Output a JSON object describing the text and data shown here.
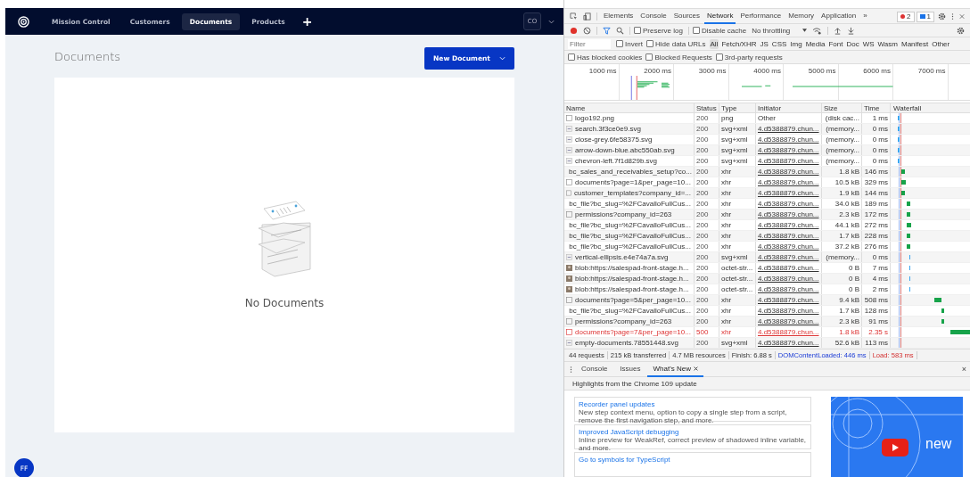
{
  "app": {
    "nav": [
      {
        "label": "Mission Control",
        "selected": false
      },
      {
        "label": "Customers",
        "selected": false
      },
      {
        "label": "Documents",
        "selected": true
      },
      {
        "label": "Products",
        "selected": false
      }
    ],
    "add_tab": "+",
    "account": "CO",
    "page_title": "Documents",
    "new_button": "New Document",
    "empty_text": "No Documents",
    "user_initials": "FF"
  },
  "devtools": {
    "tabs": [
      {
        "label": "Elements",
        "selected": false
      },
      {
        "label": "Console",
        "selected": false
      },
      {
        "label": "Sources",
        "selected": false
      },
      {
        "label": "Network",
        "selected": true
      },
      {
        "label": "Performance",
        "selected": false
      },
      {
        "label": "Memory",
        "selected": false
      },
      {
        "label": "Application",
        "selected": false
      }
    ],
    "more_tabs": "»",
    "error_count": "2",
    "message_count": "1",
    "toolbar": {
      "preserve_log": {
        "label": "Preserve log",
        "checked": false
      },
      "disable_cache": {
        "label": "Disable cache",
        "checked": false
      },
      "throttling": "No throttling"
    },
    "filter": {
      "placeholder": "Filter",
      "options": [
        {
          "label": "Invert",
          "checked": false
        },
        {
          "label": "Hide data URLs",
          "checked": false
        }
      ],
      "types": [
        {
          "label": "All",
          "selected": true
        },
        {
          "label": "Fetch/XHR",
          "selected": false
        },
        {
          "label": "JS",
          "selected": false
        },
        {
          "label": "CSS",
          "selected": false
        },
        {
          "label": "Img",
          "selected": false
        },
        {
          "label": "Media",
          "selected": false
        },
        {
          "label": "Font",
          "selected": false
        },
        {
          "label": "Doc",
          "selected": false
        },
        {
          "label": "WS",
          "selected": false
        },
        {
          "label": "Wasm",
          "selected": false
        },
        {
          "label": "Manifest",
          "selected": false
        },
        {
          "label": "Other",
          "selected": false
        }
      ],
      "extra": [
        {
          "label": "Has blocked cookies",
          "checked": false
        },
        {
          "label": "Blocked Requests",
          "checked": false
        },
        {
          "label": "3rd-party requests",
          "checked": false
        }
      ]
    },
    "overview_ticks": [
      "1000 ms",
      "2000 ms",
      "3000 ms",
      "4000 ms",
      "5000 ms",
      "6000 ms",
      "7000 ms"
    ],
    "columns": [
      "Name",
      "Status",
      "Type",
      "Initiator",
      "Size",
      "Time",
      "Waterfall"
    ],
    "rows": [
      {
        "kind": "doc",
        "name": "logo192.png",
        "status": "200",
        "type": "png",
        "initiator": "Other",
        "size": "(disk cac...",
        "time": "1 ms",
        "failed": false
      },
      {
        "kind": "image",
        "name": "search.3f3ce0e9.svg",
        "status": "200",
        "type": "svg+xml",
        "initiator": "4.d5388879.chun...",
        "size": "(memory...",
        "time": "0 ms",
        "failed": false
      },
      {
        "kind": "image",
        "name": "close-grey.6fe58375.svg",
        "status": "200",
        "type": "svg+xml",
        "initiator": "4.d5388879.chun...",
        "size": "(memory...",
        "time": "0 ms",
        "failed": false
      },
      {
        "kind": "image",
        "name": "arrow-down-blue.abc550ab.svg",
        "status": "200",
        "type": "svg+xml",
        "initiator": "4.d5388879.chun...",
        "size": "(memory...",
        "time": "0 ms",
        "failed": false
      },
      {
        "kind": "image",
        "name": "chevron-left.7f1d829b.svg",
        "status": "200",
        "type": "svg+xml",
        "initiator": "4.d5388879.chun...",
        "size": "(memory...",
        "time": "0 ms",
        "failed": false
      },
      {
        "kind": "doc",
        "name": "bc_sales_and_receivables_setup?co...",
        "status": "200",
        "type": "xhr",
        "initiator": "4.d5388879.chun...",
        "size": "1.8 kB",
        "time": "146 ms",
        "failed": false
      },
      {
        "kind": "doc",
        "name": "documents?page=1&per_page=10...",
        "status": "200",
        "type": "xhr",
        "initiator": "4.d5388879.chun...",
        "size": "10.5 kB",
        "time": "329 ms",
        "failed": false
      },
      {
        "kind": "doc",
        "name": "customer_templates?company_id=...",
        "status": "200",
        "type": "xhr",
        "initiator": "4.d5388879.chun...",
        "size": "1.9 kB",
        "time": "144 ms",
        "failed": false
      },
      {
        "kind": "doc",
        "name": "bc_file?bc_slug=%2FCavalloFullCus...",
        "status": "200",
        "type": "xhr",
        "initiator": "4.d5388879.chun...",
        "size": "34.0 kB",
        "time": "189 ms",
        "failed": false
      },
      {
        "kind": "doc",
        "name": "permissions?company_id=263",
        "status": "200",
        "type": "xhr",
        "initiator": "4.d5388879.chun...",
        "size": "2.3 kB",
        "time": "172 ms",
        "failed": false
      },
      {
        "kind": "doc",
        "name": "bc_file?bc_slug=%2FCavalloFullCus...",
        "status": "200",
        "type": "xhr",
        "initiator": "4.d5388879.chun...",
        "size": "44.1 kB",
        "time": "272 ms",
        "failed": false
      },
      {
        "kind": "doc",
        "name": "bc_file?bc_slug=%2FCavalloFullCus...",
        "status": "200",
        "type": "xhr",
        "initiator": "4.d5388879.chun...",
        "size": "1.7 kB",
        "time": "228 ms",
        "failed": false
      },
      {
        "kind": "doc",
        "name": "bc_file?bc_slug=%2FCavalloFullCus...",
        "status": "200",
        "type": "xhr",
        "initiator": "4.d5388879.chun...",
        "size": "37.2 kB",
        "time": "276 ms",
        "failed": false
      },
      {
        "kind": "image",
        "name": "vertical-ellipsis.e4e74a7a.svg",
        "status": "200",
        "type": "svg+xml",
        "initiator": "4.d5388879.chun...",
        "size": "(memory...",
        "time": "0 ms",
        "failed": false
      },
      {
        "kind": "blob",
        "name": "blob:https://salespad-front-stage.h...",
        "status": "200",
        "type": "octet-str...",
        "initiator": "4.d5388879.chun...",
        "size": "0 B",
        "time": "7 ms",
        "failed": false
      },
      {
        "kind": "blob",
        "name": "blob:https://salespad-front-stage.h...",
        "status": "200",
        "type": "octet-str...",
        "initiator": "4.d5388879.chun...",
        "size": "0 B",
        "time": "4 ms",
        "failed": false
      },
      {
        "kind": "blob",
        "name": "blob:https://salespad-front-stage.h...",
        "status": "200",
        "type": "octet-str...",
        "initiator": "4.d5388879.chun...",
        "size": "0 B",
        "time": "2 ms",
        "failed": false
      },
      {
        "kind": "doc",
        "name": "documents?page=5&per_page=10...",
        "status": "200",
        "type": "xhr",
        "initiator": "4.d5388879.chun...",
        "size": "9.4 kB",
        "time": "508 ms",
        "failed": false
      },
      {
        "kind": "doc",
        "name": "bc_file?bc_slug=%2FCavalloFullCus...",
        "status": "200",
        "type": "xhr",
        "initiator": "4.d5388879.chun...",
        "size": "1.7 kB",
        "time": "128 ms",
        "failed": false
      },
      {
        "kind": "doc",
        "name": "permissions?company_id=263",
        "status": "200",
        "type": "xhr",
        "initiator": "4.d5388879.chun...",
        "size": "2.3 kB",
        "time": "91 ms",
        "failed": false
      },
      {
        "kind": "doc",
        "name": "documents?page=7&per_page=10...",
        "status": "500",
        "type": "xhr",
        "initiator": "4.d5388879.chun...",
        "size": "1.8 kB",
        "time": "2.35 s",
        "failed": true
      },
      {
        "kind": "image",
        "name": "empty-documents.78551448.svg",
        "status": "200",
        "type": "svg+xml",
        "initiator": "4.d5388879.chun...",
        "size": "52.6 kB",
        "time": "113 ms",
        "failed": false
      }
    ],
    "summary": [
      {
        "kind": "plain",
        "text": "44 requests"
      },
      {
        "kind": "plain",
        "text": "215 kB transferred"
      },
      {
        "kind": "plain",
        "text": "4.7 MB resources"
      },
      {
        "kind": "plain",
        "text": "Finish: 6.88 s"
      },
      {
        "kind": "dom",
        "text": "DOMContentLoaded: 446 ms"
      },
      {
        "kind": "load",
        "text": "Load: 583 ms"
      }
    ],
    "drawer_tabs": [
      {
        "label": "Console",
        "selected": false,
        "closable": false
      },
      {
        "label": "Issues",
        "selected": false,
        "closable": false
      },
      {
        "label": "What's New",
        "selected": true,
        "closable": true
      }
    ],
    "drawer_close": "×",
    "highlights_title": "Highlights from the Chrome 109 update",
    "cards": [
      {
        "title": "Recorder panel updates",
        "text": "New step context menu, option to copy a single step from a script, remove the first navigation step, and more."
      },
      {
        "title": "Improved JavaScript debugging",
        "text": "Inline preview for WeakRef, correct preview of shadowed inline variable, and more."
      },
      {
        "title": "Go to symbols for TypeScript"
      }
    ],
    "video_caption": "new"
  }
}
